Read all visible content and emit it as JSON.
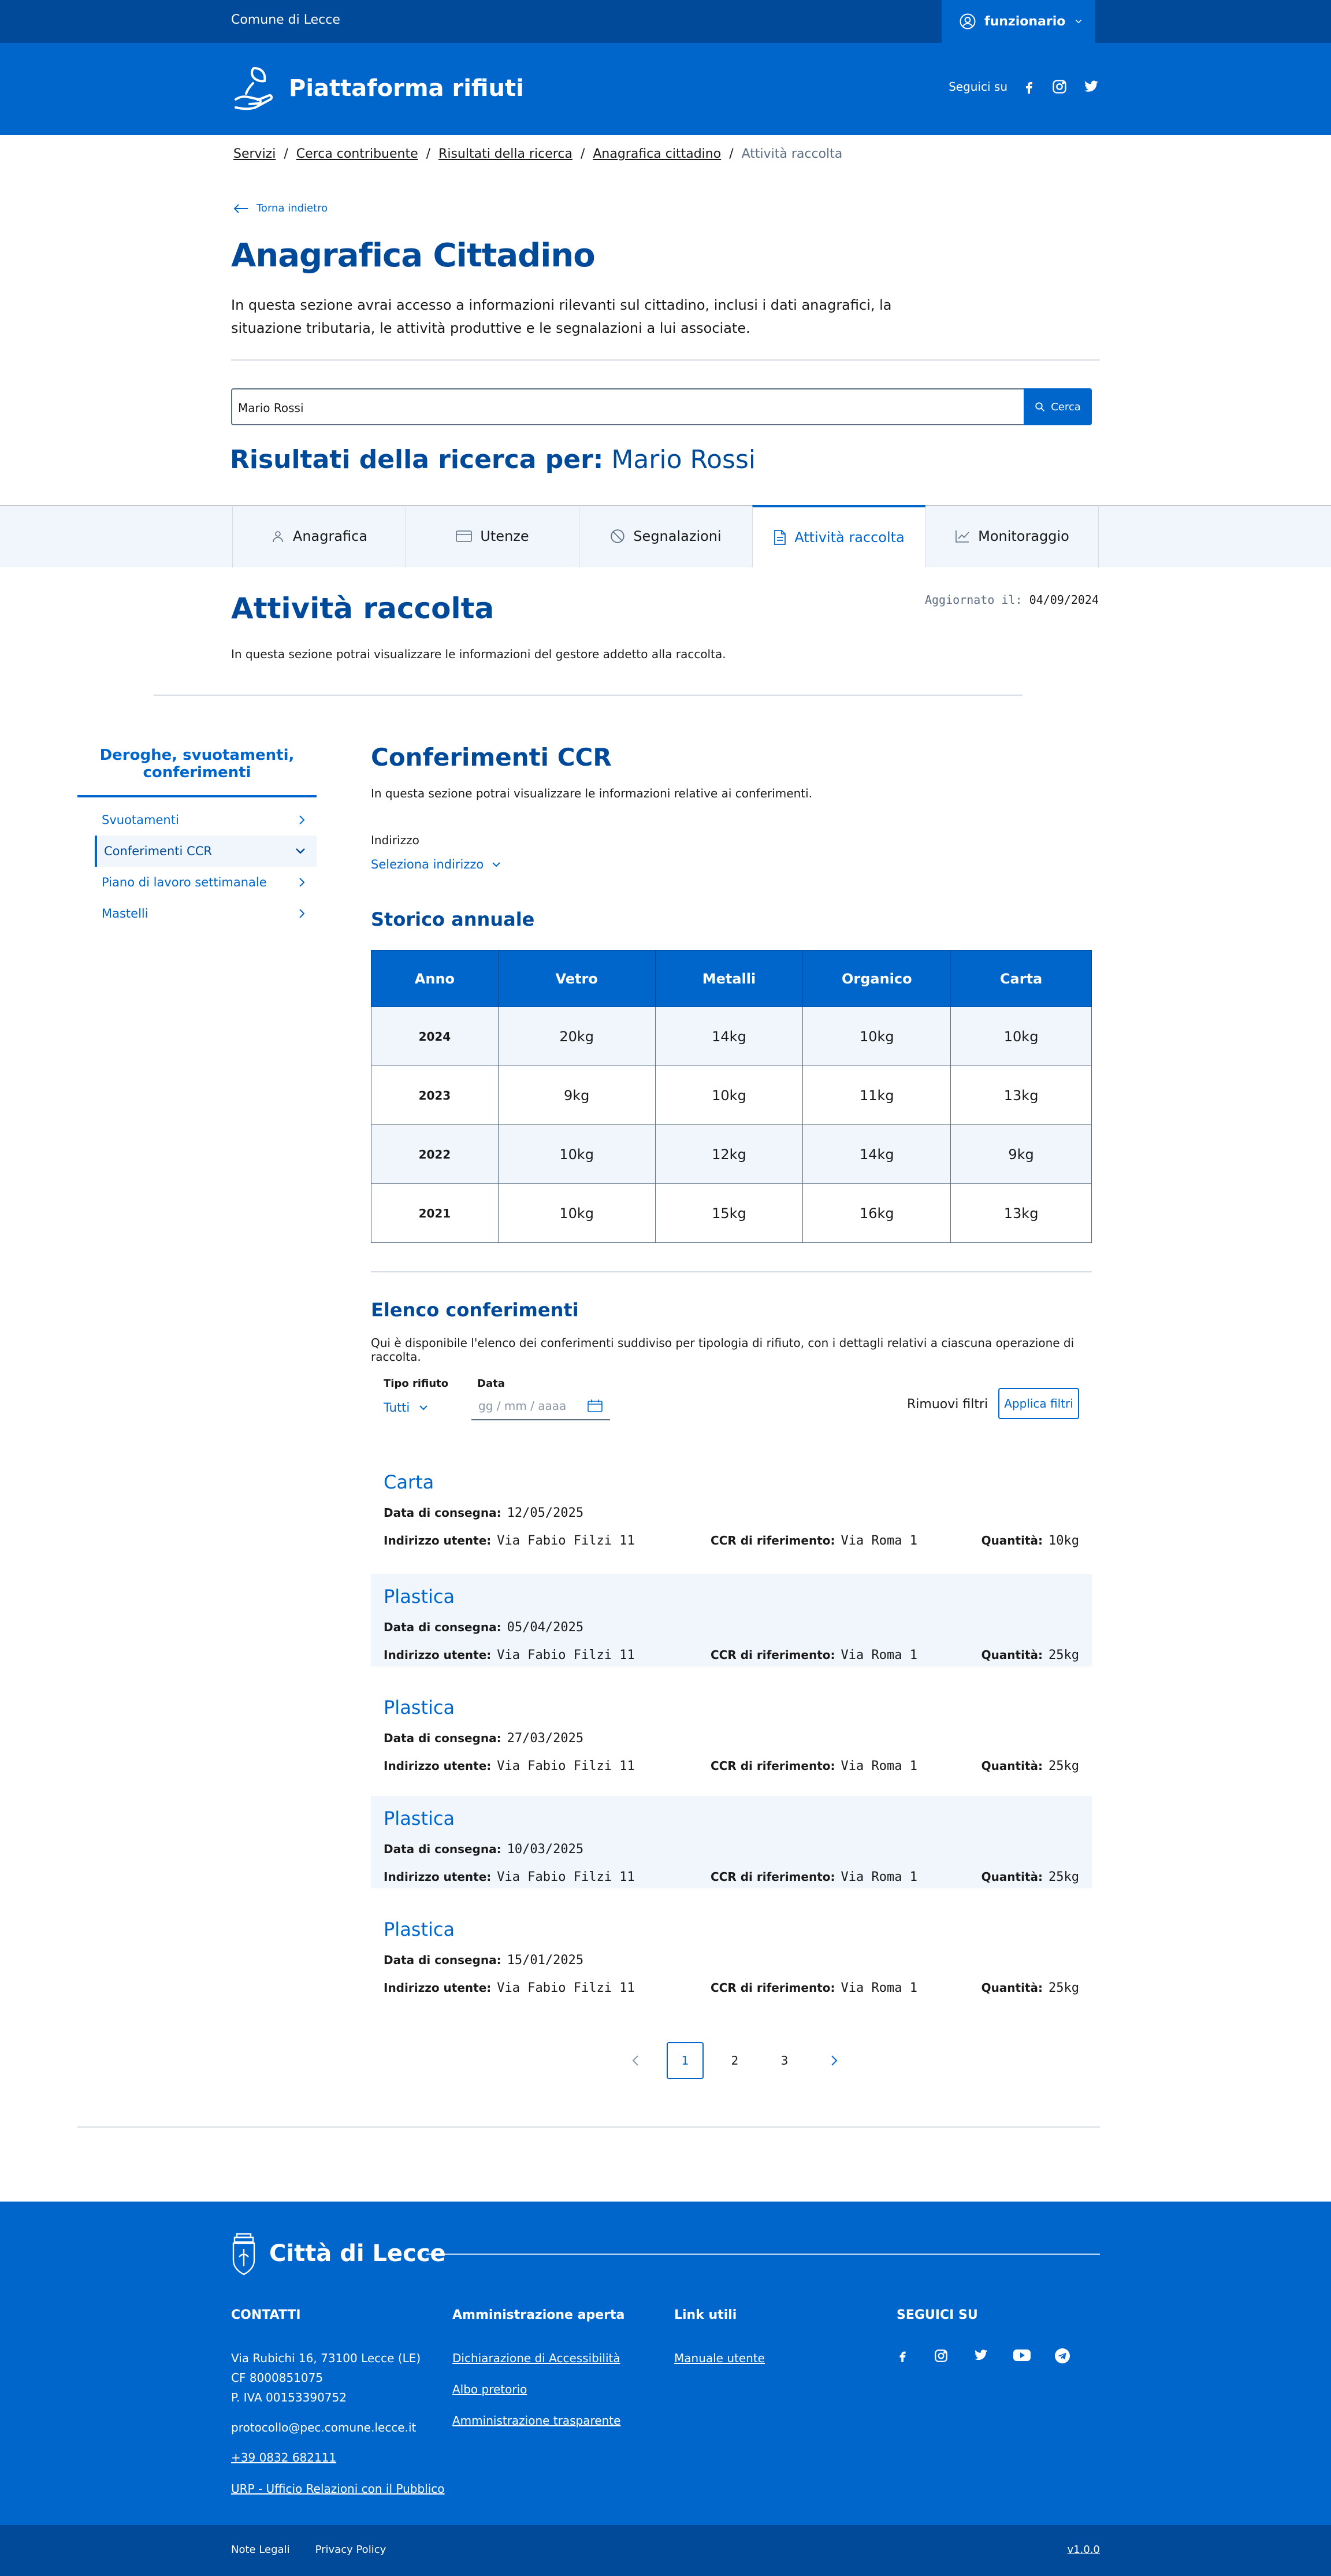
{
  "header": {
    "org": "Comune di Lecce",
    "user": "funzionario",
    "app_title": "Piattaforma rifiuti",
    "follow": "Seguici su"
  },
  "breadcrumb": [
    "Servizi",
    "Cerca contribuente",
    "Risultati della ricerca",
    "Anagrafica cittadino",
    "Attività raccolta"
  ],
  "back": "Torna indietro",
  "page": {
    "title": "Anagrafica Cittadino",
    "description": "In questa sezione avrai accesso a informazioni rilevanti sul cittadino, inclusi i dati anagrafici, la situazione tributaria, le attività produttive e le segnalazioni a lui associate."
  },
  "search": {
    "value": "Mario Rossi",
    "button": "Cerca"
  },
  "results": {
    "label": "Risultati della ricerca per:",
    "query": "Mario Rossi"
  },
  "tabs": [
    {
      "label": "Anagrafica",
      "icon": "user-icon"
    },
    {
      "label": "Utenze",
      "icon": "card-icon"
    },
    {
      "label": "Segnalazioni",
      "icon": "ban-icon"
    },
    {
      "label": "Attività raccolta",
      "icon": "file-icon",
      "active": true
    },
    {
      "label": "Monitoraggio",
      "icon": "chart-icon"
    }
  ],
  "section": {
    "title": "Attività raccolta",
    "updated_label": "Aggiornato il:",
    "updated_value": "04/09/2024",
    "description": "In questa sezione potrai visualizzare le informazioni del gestore addetto alla raccolta."
  },
  "sidebar": {
    "title": "Deroghe, svuotamenti, conferimenti",
    "items": [
      {
        "label": "Svuotamenti"
      },
      {
        "label": "Conferimenti CCR",
        "active": true
      },
      {
        "label": "Piano di lavoro settimanale"
      },
      {
        "label": "Mastelli"
      }
    ]
  },
  "ccr": {
    "title": "Conferimenti CCR",
    "description": "In questa sezione potrai visualizzare le informazioni relative ai conferimenti.",
    "address_label": "Indirizzo",
    "address_select": "Seleziona indirizzo"
  },
  "storico": {
    "title": "Storico annuale",
    "headers": [
      "Anno",
      "Vetro",
      "Metalli",
      "Organico",
      "Carta"
    ],
    "rows": [
      [
        "2024",
        "20kg",
        "14kg",
        "10kg",
        "10kg"
      ],
      [
        "2023",
        "9kg",
        "10kg",
        "11kg",
        "13kg"
      ],
      [
        "2022",
        "10kg",
        "12kg",
        "14kg",
        "9kg"
      ],
      [
        "2021",
        "10kg",
        "15kg",
        "16kg",
        "13kg"
      ]
    ]
  },
  "elenco": {
    "title": "Elenco conferimenti",
    "description": "Qui è disponibile l'elenco dei conferimenti suddiviso per tipologia di rifiuto, con i dettagli relativi a ciascuna operazione di raccolta.",
    "filter_type_label": "Tipo rifiuto",
    "filter_type_value": "Tutti",
    "filter_date_label": "Data",
    "filter_date_placeholder": "gg / mm / aaaa",
    "reset": "Rimuovi filtri",
    "apply": "Applica filtri",
    "labels": {
      "date": "Data di consegna:",
      "address": "Indirizzo utente:",
      "ccr": "CCR di riferimento:",
      "qty": "Quantità:"
    },
    "records": [
      {
        "type": "Carta",
        "date": "12/05/2025",
        "address": "Via Fabio Filzi 11",
        "ccr": "Via Roma 1",
        "qty": "10kg"
      },
      {
        "type": "Plastica",
        "date": "05/04/2025",
        "address": "Via Fabio Filzi 11",
        "ccr": "Via Roma 1",
        "qty": "25kg"
      },
      {
        "type": "Plastica",
        "date": "27/03/2025",
        "address": "Via Fabio Filzi 11",
        "ccr": "Via Roma 1",
        "qty": "25kg"
      },
      {
        "type": "Plastica",
        "date": "10/03/2025",
        "address": "Via Fabio Filzi 11",
        "ccr": "Via Roma 1",
        "qty": "25kg"
      },
      {
        "type": "Plastica",
        "date": "15/01/2025",
        "address": "Via Fabio Filzi 11",
        "ccr": "Via Roma 1",
        "qty": "25kg"
      }
    ]
  },
  "pagination": [
    "1",
    "2",
    "3"
  ],
  "footer": {
    "brand": "Città di Lecce",
    "contacts_title": "CONTATTI",
    "address": "Via Rubichi 16, 73100 Lecce (LE)",
    "cf": "CF 8000851075",
    "piva": "P. IVA 00153390752",
    "email": "protocollo@pec.comune.lecce.it",
    "phone": "+39 0832 682111",
    "urp": "URP - Ufficio Relazioni con il Pubblico",
    "admin_title": "Amministrazione aperta",
    "admin_links": [
      "Dichiarazione di Accessibilità",
      "Albo pretorio",
      "Amministrazione trasparente"
    ],
    "links_title": "Link utili",
    "links": [
      "Manuale utente"
    ],
    "follow_title": "SEGUICI SU",
    "legal": "Note Legali",
    "privacy": "Privacy Policy",
    "version": "v1.0.0"
  },
  "colors": {
    "primary": "#0066cc",
    "dark": "#004a99",
    "light_bg": "#f0f6fc"
  }
}
